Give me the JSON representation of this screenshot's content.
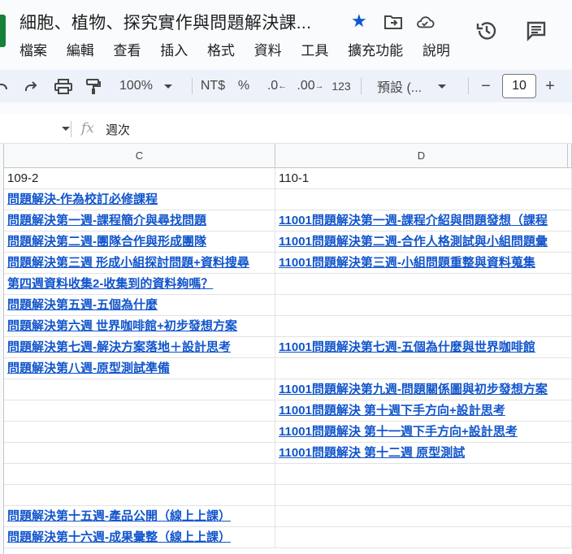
{
  "document": {
    "title": "細胞、植物、探究實作與問題解決課..."
  },
  "menu": [
    "檔案",
    "編輯",
    "查看",
    "插入",
    "格式",
    "資料",
    "工具",
    "擴充功能",
    "說明"
  ],
  "toolbar": {
    "zoom": "100%",
    "currency": "NT$",
    "percent": "%",
    "decrease_decimal": ".0",
    "increase_decimal": ".00",
    "number_format": "123",
    "font": "預設 (...",
    "font_size": "10",
    "minus": "−",
    "plus": "+"
  },
  "formula_bar": {
    "fx": "fx",
    "content": "週次"
  },
  "columns": [
    "C",
    "D"
  ],
  "rows": [
    {
      "c": "109-2",
      "c_link": false,
      "d": "110-1",
      "d_link": false
    },
    {
      "c": "問題解決-作為校訂必修課程",
      "c_link": true,
      "d": "",
      "d_link": false
    },
    {
      "c": "問題解決第一週-課程簡介與尋找問題",
      "c_link": true,
      "d": "11001問題解決第一週-課程介紹與問題發想（課程",
      "d_link": true
    },
    {
      "c": "問題解決第二週-團隊合作與形成團隊",
      "c_link": true,
      "d": "11001問題解決第二週-合作人格測試與小組問題彙",
      "d_link": true
    },
    {
      "c": "問題解決第三週 形成小組探討問題+資料搜尋",
      "c_link": true,
      "d": "11001問題解決第三週-小組問題重整與資料蒐集",
      "d_link": true
    },
    {
      "c": "第四週資料收集2-收集到的資料夠嗎？",
      "c_link": true,
      "d": "",
      "d_link": false
    },
    {
      "c": "問題解決第五週-五個為什麼",
      "c_link": true,
      "d": "",
      "d_link": false
    },
    {
      "c": "問題解決第六週 世界咖啡館+初步發想方案",
      "c_link": true,
      "d": "",
      "d_link": false
    },
    {
      "c": "問題解決第七週-解決方案落地＋設計思考",
      "c_link": true,
      "d": "11001問題解決第七週-五個為什麼與世界咖啡館",
      "d_link": true
    },
    {
      "c": "問題解決第八週-原型測試準備",
      "c_link": true,
      "d": "",
      "d_link": false
    },
    {
      "c": "",
      "c_link": false,
      "d": "11001問題解決第九週-問題關係圖與初步發想方案",
      "d_link": true
    },
    {
      "c": "",
      "c_link": false,
      "d": "11001問題解決 第十週下手方向+設計思考",
      "d_link": true
    },
    {
      "c": "",
      "c_link": false,
      "d": "11001問題解決 第十一週下手方向+設計思考",
      "d_link": true
    },
    {
      "c": "",
      "c_link": false,
      "d": "11001問題解決 第十二週 原型測試",
      "d_link": true
    },
    {
      "c": "",
      "c_link": false,
      "d": "",
      "d_link": false
    },
    {
      "c": "",
      "c_link": false,
      "d": "",
      "d_link": false
    },
    {
      "c": "問題解決第十五週-產品公開（線上上課）",
      "c_link": true,
      "d": "",
      "d_link": false
    },
    {
      "c": "問題解決第十六週-成果彙整（線上上課）",
      "c_link": true,
      "d": "",
      "d_link": false
    }
  ],
  "colors": {
    "link": "#1155cc",
    "accent": "#0b57d0",
    "sheets_green": "#188038",
    "toolbar_bg": "#edf2fa"
  },
  "icons": [
    "star-icon",
    "move-to-folder-icon",
    "cloud-saved-icon",
    "history-icon",
    "comments-icon",
    "undo-icon",
    "redo-icon",
    "print-icon",
    "paint-format-icon"
  ]
}
